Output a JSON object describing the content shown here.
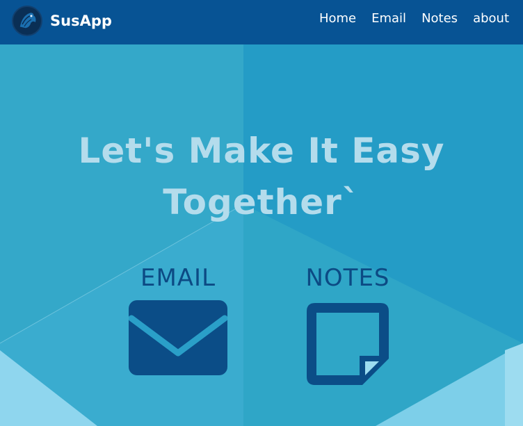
{
  "navbar": {
    "brand": "SusApp",
    "logo_icon": "horse-head-logo-icon",
    "links": [
      {
        "label": "Home"
      },
      {
        "label": "Email"
      },
      {
        "label": "Notes"
      },
      {
        "label": "about"
      }
    ]
  },
  "hero": {
    "title_line1": "Let's Make It Easy",
    "title_line2": "Together`"
  },
  "features": {
    "email": {
      "label": "EMAIL",
      "icon": "envelope-icon"
    },
    "notes": {
      "label": "NOTES",
      "icon": "sticky-note-icon"
    }
  },
  "colors": {
    "navbar": "#075394",
    "hero_background": "#2a9fc8",
    "title_text": "#b4dcec",
    "feature_dark": "#0c4a84"
  }
}
